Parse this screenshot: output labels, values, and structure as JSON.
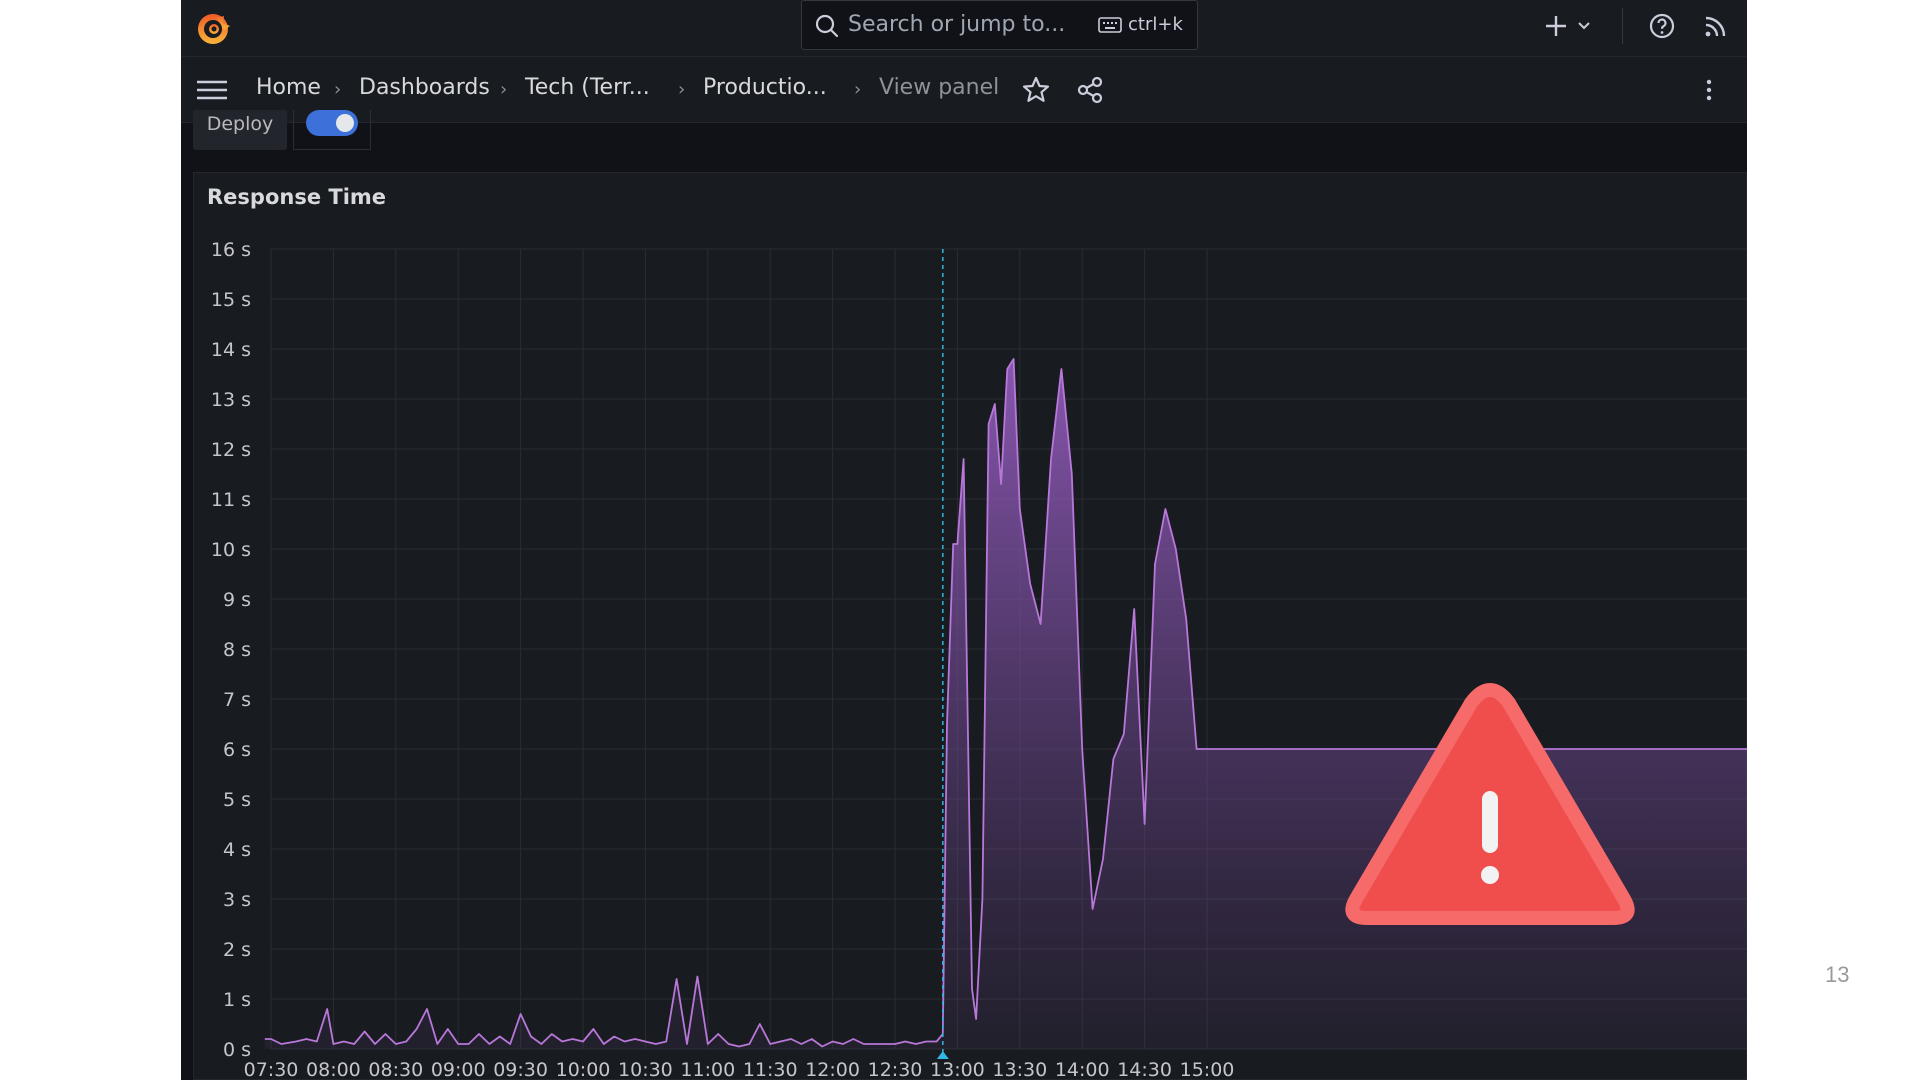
{
  "topbar": {
    "search_placeholder": "Search or jump to...",
    "search_shortcut": "ctrl+k"
  },
  "breadcrumbs": [
    "Home",
    "Dashboards",
    "Tech (Terr...",
    "Productio...",
    "View panel"
  ],
  "variables": {
    "deploy_label": "Deploy",
    "deploy_toggle_on": true
  },
  "panel": {
    "title": "Response Time"
  },
  "chart_data": {
    "type": "area",
    "title": "Response Time",
    "y_unit": "s",
    "ylim": [
      0,
      16
    ],
    "y_ticks": [
      "0 s",
      "1 s",
      "2 s",
      "3 s",
      "4 s",
      "5 s",
      "6 s",
      "7 s",
      "8 s",
      "9 s",
      "10 s",
      "11 s",
      "12 s",
      "13 s",
      "14 s",
      "15 s",
      "16 s"
    ],
    "x_ticks": [
      "07:30",
      "08:00",
      "08:30",
      "09:00",
      "09:30",
      "10:00",
      "10:30",
      "11:00",
      "11:30",
      "12:00",
      "12:30",
      "13:00",
      "13:30",
      "14:00",
      "14:30",
      "15:00"
    ],
    "xlim": [
      "07:30",
      "15:22"
    ],
    "grid": true,
    "annotation": {
      "x": "12:53",
      "label": "Deploy"
    },
    "series": [
      {
        "color": "#b877d9",
        "x": [
          "07:27",
          "07:30",
          "07:35",
          "07:42",
          "07:47",
          "07:52",
          "07:57",
          "08:00",
          "08:05",
          "08:10",
          "08:15",
          "08:20",
          "08:25",
          "08:30",
          "08:35",
          "08:40",
          "08:45",
          "08:50",
          "08:55",
          "09:00",
          "09:05",
          "09:10",
          "09:15",
          "09:20",
          "09:25",
          "09:30",
          "09:35",
          "09:40",
          "09:45",
          "09:50",
          "09:55",
          "10:00",
          "10:05",
          "10:10",
          "10:15",
          "10:20",
          "10:25",
          "10:30",
          "10:35",
          "10:40",
          "10:45",
          "10:50",
          "10:55",
          "11:00",
          "11:05",
          "11:10",
          "11:15",
          "11:20",
          "11:25",
          "11:30",
          "11:35",
          "11:40",
          "11:45",
          "11:50",
          "11:55",
          "12:00",
          "12:05",
          "12:10",
          "12:15",
          "12:20",
          "12:25",
          "12:30",
          "12:35",
          "12:40",
          "12:45",
          "12:50",
          "12:53",
          "12:55",
          "12:58",
          "13:00",
          "13:03",
          "13:07",
          "13:09",
          "13:12",
          "13:15",
          "13:18",
          "13:21",
          "13:24",
          "13:27",
          "13:30",
          "13:35",
          "13:40",
          "13:45",
          "13:50",
          "13:55",
          "14:00",
          "14:05",
          "14:10",
          "14:15",
          "14:20",
          "14:25",
          "14:30",
          "14:35",
          "14:40",
          "14:45",
          "14:50",
          "14:55",
          "15:00",
          "15:05",
          "15:10",
          "15:15",
          "15:22"
        ],
        "values": [
          0.2,
          0.2,
          0.1,
          0.15,
          0.2,
          0.15,
          0.8,
          0.1,
          0.15,
          0.1,
          0.35,
          0.1,
          0.3,
          0.1,
          0.15,
          0.4,
          0.8,
          0.1,
          0.4,
          0.1,
          0.1,
          0.3,
          0.1,
          0.25,
          0.1,
          0.7,
          0.25,
          0.1,
          0.3,
          0.15,
          0.2,
          0.15,
          0.4,
          0.1,
          0.25,
          0.15,
          0.2,
          0.15,
          0.1,
          0.15,
          1.4,
          0.1,
          1.45,
          0.1,
          0.3,
          0.1,
          0.05,
          0.1,
          0.5,
          0.1,
          0.15,
          0.2,
          0.1,
          0.2,
          0.05,
          0.15,
          0.1,
          0.2,
          0.1,
          0.1,
          0.1,
          0.1,
          0.15,
          0.1,
          0.15,
          0.15,
          0.3,
          6.5,
          10.1,
          10.1,
          11.8,
          1.2,
          0.6,
          3.0,
          12.5,
          12.9,
          11.3,
          13.6,
          13.8,
          10.8,
          9.3,
          8.5,
          11.8,
          13.6,
          11.5,
          6.0,
          2.8,
          3.8,
          5.8,
          6.3,
          8.8,
          4.5,
          9.7,
          10.8,
          10.0,
          8.6,
          6.0,
          6.0,
          6.0,
          6.0,
          6.0,
          6.0
        ],
        "truncate_to": 97
      }
    ]
  }
}
